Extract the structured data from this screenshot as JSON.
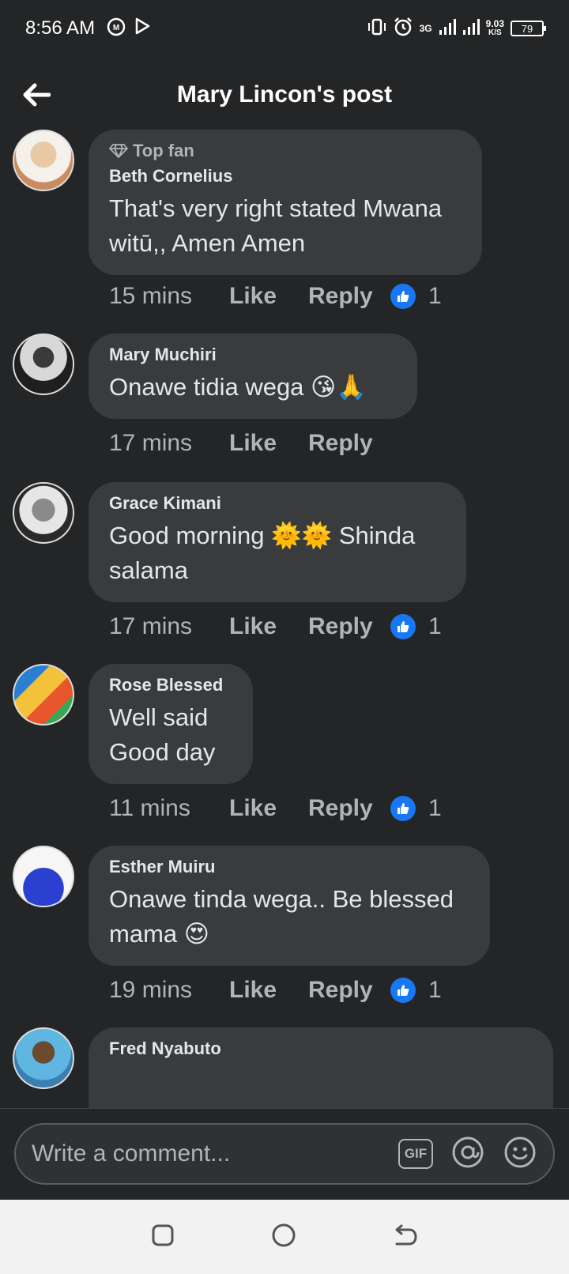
{
  "status_bar": {
    "time": "8:56 AM",
    "network": "3G",
    "speed": "9.03",
    "speed_unit": "K/S",
    "battery": "79"
  },
  "header": {
    "title": "Mary Lincon's post"
  },
  "comments": [
    {
      "badge": "Top fan",
      "author": "Beth Cornelius",
      "text": "That's very right stated Mwana\nwitū,, Amen Amen",
      "time": "15 mins",
      "like": "Like",
      "reply": "Reply",
      "reactions": "1"
    },
    {
      "author": "Mary Muchiri",
      "text": "Onawe tidia wega 😘🙏",
      "time": "17 mins",
      "like": "Like",
      "reply": "Reply"
    },
    {
      "author": "Grace Kimani",
      "text": "Good morning 🌞🌞 Shinda\nsalama",
      "time": "17 mins",
      "like": "Like",
      "reply": "Reply",
      "reactions": "1"
    },
    {
      "author": "Rose Blessed",
      "text": "Well said\nGood day",
      "time": "11 mins",
      "like": "Like",
      "reply": "Reply",
      "reactions": "1"
    },
    {
      "author": "Esther Muiru",
      "text": "Onawe tinda wega.. Be blessed\nmama 😍",
      "time": "19 mins",
      "like": "Like",
      "reply": "Reply",
      "reactions": "1"
    },
    {
      "author": "Fred Nyabuto"
    }
  ],
  "composer": {
    "placeholder": "Write a comment...",
    "gif_label": "GIF"
  },
  "colors": {
    "background": "#242526",
    "bubble": "#3a3b3c",
    "like_blue": "#1877f2",
    "muted_text": "#b0b3b8"
  }
}
